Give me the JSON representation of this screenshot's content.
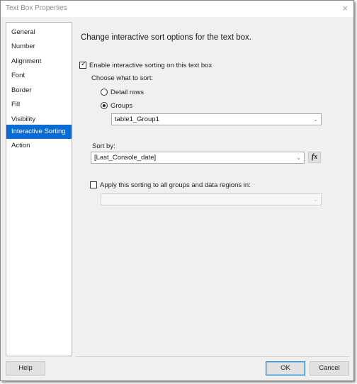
{
  "window": {
    "title": "Text Box Properties",
    "close_icon": "×"
  },
  "nav": {
    "items": [
      {
        "label": "General",
        "selected": false
      },
      {
        "label": "Number",
        "selected": false
      },
      {
        "label": "Alignment",
        "selected": false
      },
      {
        "label": "Font",
        "selected": false
      },
      {
        "label": "Border",
        "selected": false
      },
      {
        "label": "Fill",
        "selected": false
      },
      {
        "label": "Visibility",
        "selected": false
      },
      {
        "label": "Interactive Sorting",
        "selected": true
      },
      {
        "label": "Action",
        "selected": false
      }
    ]
  },
  "main": {
    "heading": "Change interactive sort options for the text box.",
    "enable_checkbox": {
      "label": "Enable interactive sorting on this text box",
      "checked": true
    },
    "choose_label": "Choose what to sort:",
    "radios": [
      {
        "label": "Detail rows",
        "selected": false
      },
      {
        "label": "Groups",
        "selected": true
      }
    ],
    "group_combo": {
      "value": "table1_Group1"
    },
    "sort_by": {
      "label": "Sort by:",
      "value": "[Last_Console_date]",
      "fx_label": "fx"
    },
    "apply_checkbox": {
      "label": "Apply this sorting to all groups and data regions in:",
      "checked": false
    },
    "apply_combo": {
      "value": "",
      "disabled": true
    }
  },
  "footer": {
    "help": "Help",
    "ok": "OK",
    "cancel": "Cancel"
  },
  "colors": {
    "accent": "#0a6bd3",
    "background": "#f0f0f0"
  }
}
